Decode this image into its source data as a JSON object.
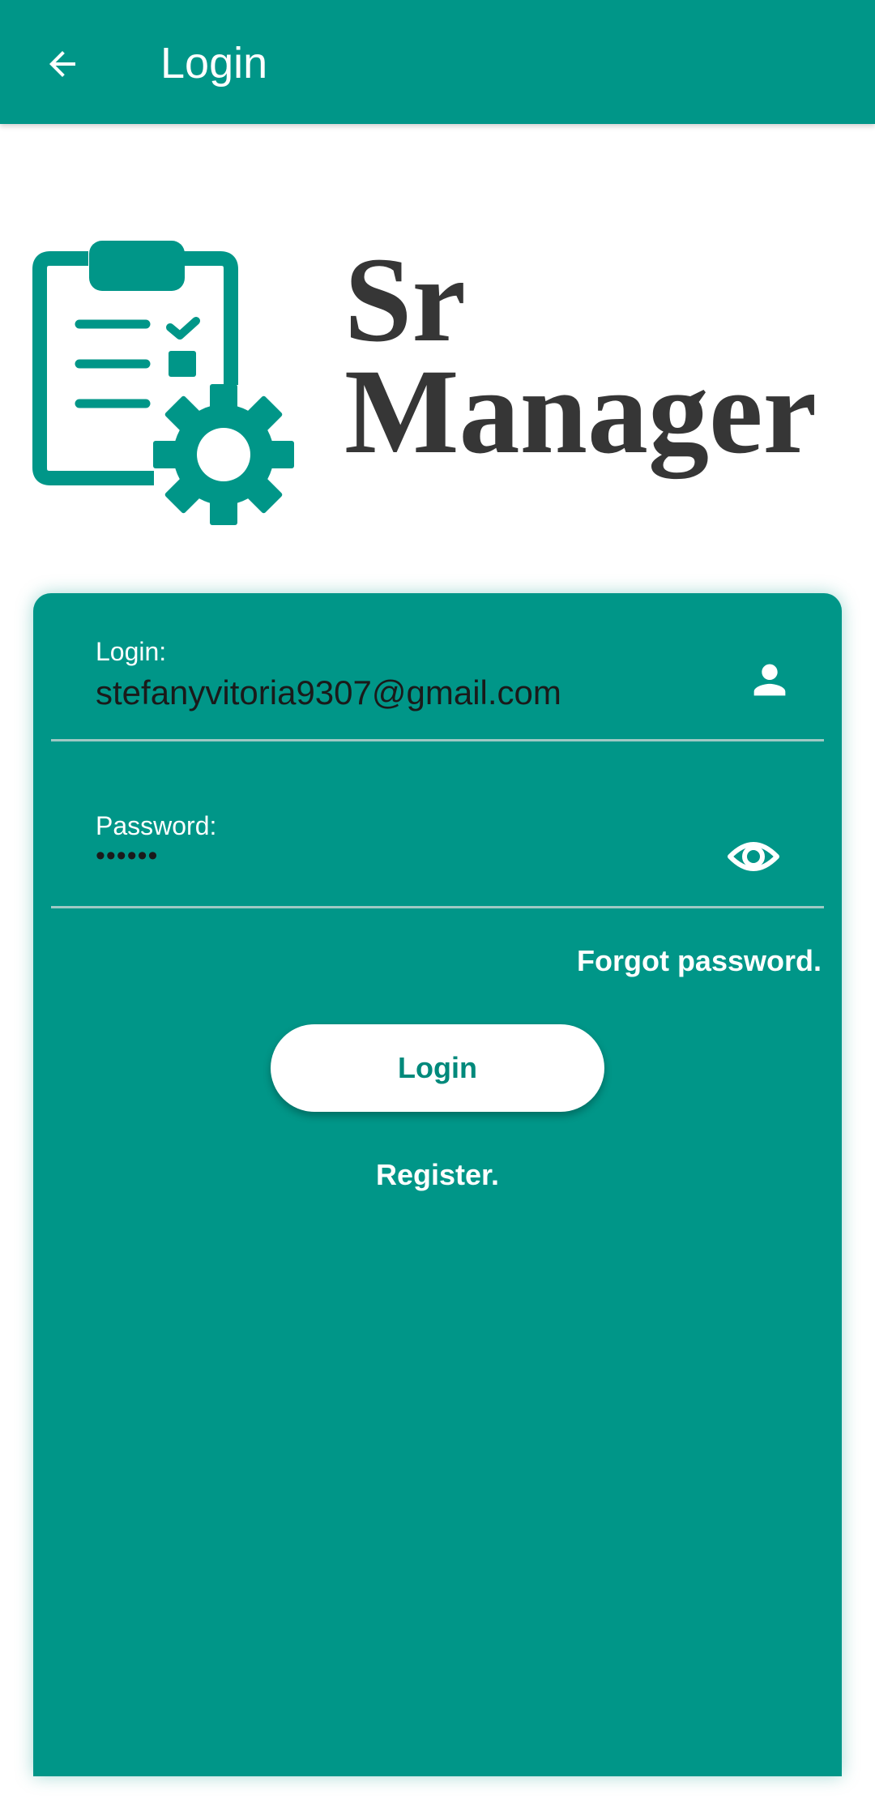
{
  "app_bar": {
    "title": "Login",
    "back_icon": "arrow-left-icon",
    "background_color": "#009688"
  },
  "logo": {
    "icon": "clipboard-gear-icon",
    "line1": "Sr",
    "line2": "Manager",
    "icon_color": "#009688",
    "text_color": "#363636"
  },
  "form": {
    "login": {
      "label": "Login:",
      "value": "stefanyvitoria9307@gmail.com",
      "icon": "person-icon"
    },
    "password": {
      "label": "Password:",
      "value": "••••••",
      "icon": "eye-icon"
    },
    "forgot_password": "Forgot password.",
    "login_button": "Login",
    "register": "Register."
  },
  "colors": {
    "accent": "#009688",
    "button_text": "#00897b"
  }
}
